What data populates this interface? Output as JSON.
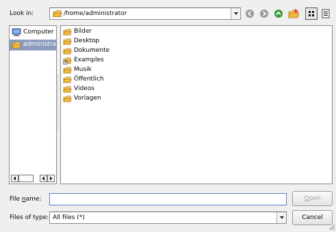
{
  "lookin": {
    "label": "Look in:",
    "path": "/home/administrator"
  },
  "toolbar": {
    "icons": [
      "back-icon",
      "forward-icon",
      "parent-dir-icon",
      "new-folder-icon",
      "list-view-icon",
      "detail-view-icon"
    ]
  },
  "sidebar": {
    "items": [
      {
        "label": "Computer",
        "icon": "computer-icon"
      },
      {
        "label": "administrat",
        "icon": "folder-icon"
      }
    ]
  },
  "files": {
    "items": [
      {
        "label": "Bilder",
        "icon": "folder-icon"
      },
      {
        "label": "Desktop",
        "icon": "folder-icon"
      },
      {
        "label": "Dokumente",
        "icon": "folder-icon"
      },
      {
        "label": "Examples",
        "icon": "folder-link-icon"
      },
      {
        "label": "Musik",
        "icon": "folder-icon"
      },
      {
        "label": "Öffentlich",
        "icon": "folder-icon"
      },
      {
        "label": "Videos",
        "icon": "folder-icon"
      },
      {
        "label": "Vorlagen",
        "icon": "folder-icon"
      }
    ]
  },
  "filename": {
    "label_pre": "File ",
    "label_mnemonic": "n",
    "label_post": "ame:",
    "value": ""
  },
  "filetype": {
    "label": "Files of type:",
    "value": "All files (*)"
  },
  "buttons": {
    "open_mnemonic": "O",
    "open_rest": "pen",
    "cancel": "Cancel"
  },
  "colors": {
    "selection": "#8c9cbf",
    "folder_fill": "#f2c14e",
    "folder_edge": "#b07a1a",
    "nav_icon": "#9a9a9a",
    "up_icon": "#3c9a3c"
  }
}
